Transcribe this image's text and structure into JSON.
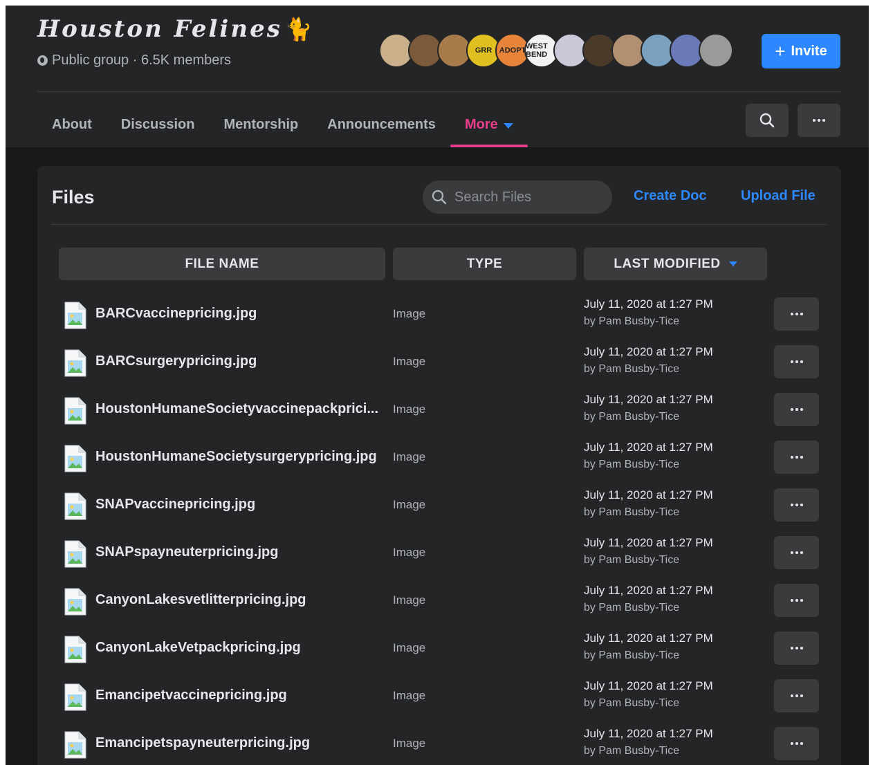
{
  "group": {
    "title": "Houston Felines",
    "meta": "Public group · 6.5K members",
    "invite_label": "Invite"
  },
  "avatars": [
    {
      "label": "",
      "color": "#c9b08a"
    },
    {
      "label": "",
      "color": "#7a5a3a"
    },
    {
      "label": "",
      "color": "#a87c4a"
    },
    {
      "label": "GRR",
      "color": "#e0c020"
    },
    {
      "label": "ADOPT",
      "color": "#e8833a"
    },
    {
      "label": "WEST BEND",
      "color": "#f2f2f2"
    },
    {
      "label": "",
      "color": "#c8c8d8"
    },
    {
      "label": "",
      "color": "#4a3a2a"
    },
    {
      "label": "",
      "color": "#b09070"
    },
    {
      "label": "",
      "color": "#7aa0c0"
    },
    {
      "label": "",
      "color": "#6a7ab8"
    },
    {
      "label": "",
      "color": "#9a9a9a"
    }
  ],
  "tabs": [
    {
      "label": "About",
      "active": false
    },
    {
      "label": "Discussion",
      "active": false
    },
    {
      "label": "Mentorship",
      "active": false
    },
    {
      "label": "Announcements",
      "active": false
    },
    {
      "label": "More",
      "active": true
    }
  ],
  "files": {
    "title": "Files",
    "search_placeholder": "Search Files",
    "create_doc_label": "Create Doc",
    "upload_file_label": "Upload File",
    "columns": {
      "name": "FILE NAME",
      "type": "TYPE",
      "modified": "LAST MODIFIED"
    },
    "rows": [
      {
        "name": "BARCvaccinepricing.jpg",
        "type": "Image",
        "date": "July 11, 2020 at 1:27 PM",
        "by": "by Pam Busby-Tice"
      },
      {
        "name": "BARCsurgerypricing.jpg",
        "type": "Image",
        "date": "July 11, 2020 at 1:27 PM",
        "by": "by Pam Busby-Tice"
      },
      {
        "name": "HoustonHumaneSocietyvaccinepackprici...",
        "type": "Image",
        "date": "July 11, 2020 at 1:27 PM",
        "by": "by Pam Busby-Tice"
      },
      {
        "name": "HoustonHumaneSocietysurgerypricing.jpg",
        "type": "Image",
        "date": "July 11, 2020 at 1:27 PM",
        "by": "by Pam Busby-Tice"
      },
      {
        "name": "SNAPvaccinepricing.jpg",
        "type": "Image",
        "date": "July 11, 2020 at 1:27 PM",
        "by": "by Pam Busby-Tice"
      },
      {
        "name": "SNAPspayneuterpricing.jpg",
        "type": "Image",
        "date": "July 11, 2020 at 1:27 PM",
        "by": "by Pam Busby-Tice"
      },
      {
        "name": "CanyonLakesvetlitterpricing.jpg",
        "type": "Image",
        "date": "July 11, 2020 at 1:27 PM",
        "by": "by Pam Busby-Tice"
      },
      {
        "name": "CanyonLakeVetpackpricing.jpg",
        "type": "Image",
        "date": "July 11, 2020 at 1:27 PM",
        "by": "by Pam Busby-Tice"
      },
      {
        "name": "Emancipetvaccinepricing.jpg",
        "type": "Image",
        "date": "July 11, 2020 at 1:27 PM",
        "by": "by Pam Busby-Tice"
      },
      {
        "name": "Emancipetspayneuterpricing.jpg",
        "type": "Image",
        "date": "July 11, 2020 at 1:27 PM",
        "by": "by Pam Busby-Tice"
      }
    ]
  },
  "colors": {
    "accent_blue": "#2d88ff",
    "active_tab": "#e83e8c",
    "background": "#18191a",
    "surface": "#242526",
    "button": "#3a3b3c"
  },
  "icons": {
    "globe": "globe-icon",
    "cat": "cat-icon",
    "search": "search-icon",
    "more": "more-icon",
    "plus": "plus-icon",
    "file": "image-file-icon",
    "caret": "caret-down-icon"
  }
}
